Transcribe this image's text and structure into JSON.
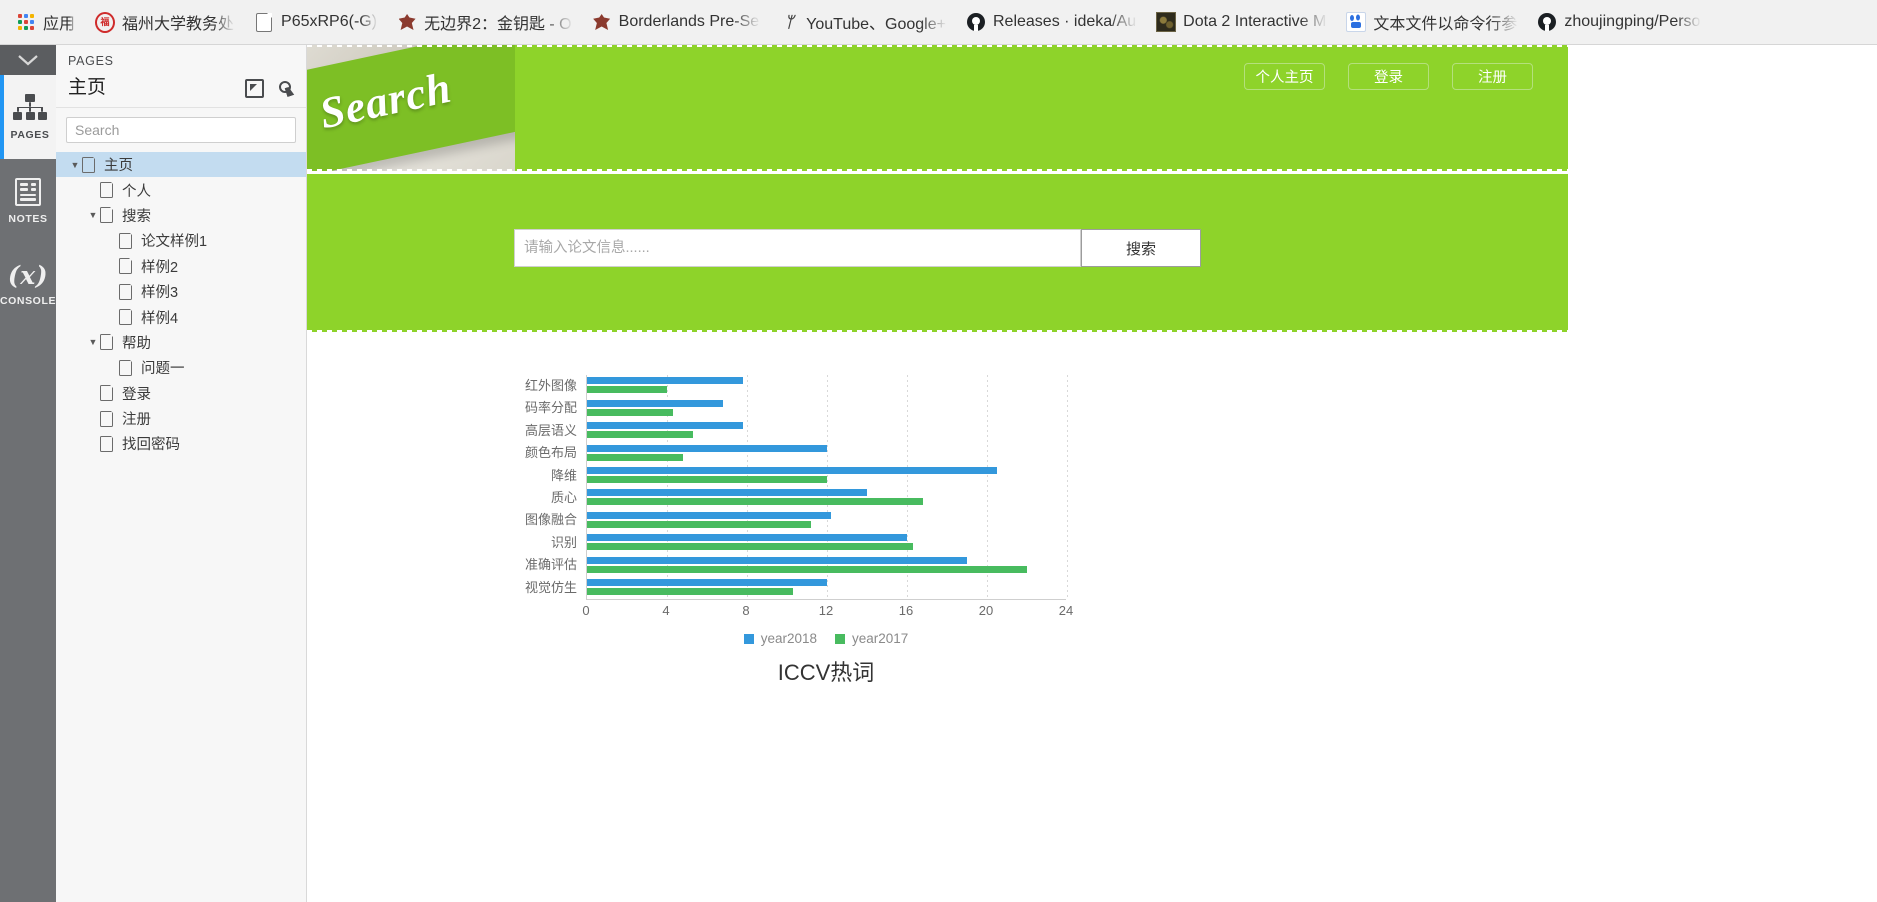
{
  "browser": {
    "bookmarks": [
      {
        "icon": "apps-grid-icon",
        "label": "应用"
      },
      {
        "icon": "fuzhou-university-icon",
        "label": "福州大学教务处"
      },
      {
        "icon": "document-icon",
        "label": "P65xRP6(-G)"
      },
      {
        "icon": "borderlands-icon",
        "label": "无边界2：金钥匙 - O"
      },
      {
        "icon": "borderlands-icon",
        "label": "Borderlands Pre-Se"
      },
      {
        "icon": "youtube-icon",
        "label": "YouTube、Google+"
      },
      {
        "icon": "github-icon",
        "label": "Releases · ideka/Au"
      },
      {
        "icon": "dota-icon",
        "label": "Dota 2 Interactive M"
      },
      {
        "icon": "baidu-icon",
        "label": "文本文件以命令行参"
      },
      {
        "icon": "github-icon",
        "label": "zhoujingping/Perso"
      }
    ]
  },
  "rail": {
    "collapse_icon": "chevron-down-icon",
    "items": [
      {
        "label": "PAGES",
        "icon": "sitemap-icon",
        "active": true
      },
      {
        "label": "NOTES",
        "icon": "notes-icon",
        "active": false
      },
      {
        "label": "CONSOLE",
        "icon": "console-icon",
        "active": false
      }
    ]
  },
  "pages_panel": {
    "kicker": "PAGES",
    "title": "主页",
    "tools": [
      {
        "name": "export-icon"
      },
      {
        "name": "preview-icon"
      }
    ],
    "search": {
      "value": "",
      "placeholder": "Search"
    },
    "tree": [
      {
        "label": "主页",
        "indent": 0,
        "twisty": "down",
        "selected": true
      },
      {
        "label": "个人",
        "indent": 1,
        "twisty": "none",
        "selected": false
      },
      {
        "label": "搜索",
        "indent": 1,
        "twisty": "down",
        "selected": false
      },
      {
        "label": "论文样例1",
        "indent": 2,
        "twisty": "none",
        "selected": false
      },
      {
        "label": "样例2",
        "indent": 2,
        "twisty": "none",
        "selected": false
      },
      {
        "label": "样例3",
        "indent": 2,
        "twisty": "none",
        "selected": false
      },
      {
        "label": "样例4",
        "indent": 2,
        "twisty": "none",
        "selected": false
      },
      {
        "label": "帮助",
        "indent": 1,
        "twisty": "down",
        "selected": false
      },
      {
        "label": "问题一",
        "indent": 2,
        "twisty": "none",
        "selected": false
      },
      {
        "label": "登录",
        "indent": 1,
        "twisty": "none",
        "selected": false
      },
      {
        "label": "注册",
        "indent": 1,
        "twisty": "none",
        "selected": false
      },
      {
        "label": "找回密码",
        "indent": 1,
        "twisty": "none",
        "selected": false
      }
    ]
  },
  "prototype": {
    "brand_green": "#8ed32a",
    "hero": {
      "banner_word": "Search",
      "buttons": [
        {
          "label": "个人主页"
        },
        {
          "label": "登录"
        },
        {
          "label": "注册"
        }
      ]
    },
    "search_band": {
      "input": {
        "value": "",
        "placeholder": "请输入论文信息......"
      },
      "button_label": "搜索"
    }
  },
  "chart_data": {
    "type": "bar",
    "orientation": "horizontal",
    "title": "ICCV热词",
    "xlabel": "",
    "ylabel": "",
    "xlim": [
      0,
      24
    ],
    "xticks": [
      0,
      4,
      8,
      12,
      16,
      20,
      24
    ],
    "grid": true,
    "legend_position": "bottom",
    "categories": [
      "红外图像",
      "码率分配",
      "高层语义",
      "颜色布局",
      "降维",
      "质心",
      "图像融合",
      "识别",
      "准确评估",
      "视觉仿生"
    ],
    "series": [
      {
        "name": "year2018",
        "color": "#3398dc",
        "values": [
          7.8,
          6.8,
          7.8,
          12,
          20.5,
          14,
          12.2,
          16,
          19,
          12
        ]
      },
      {
        "name": "year2017",
        "color": "#48bb5f",
        "values": [
          4,
          4.3,
          5.3,
          4.8,
          12,
          16.8,
          11.2,
          16.3,
          22,
          10.3
        ]
      }
    ]
  }
}
